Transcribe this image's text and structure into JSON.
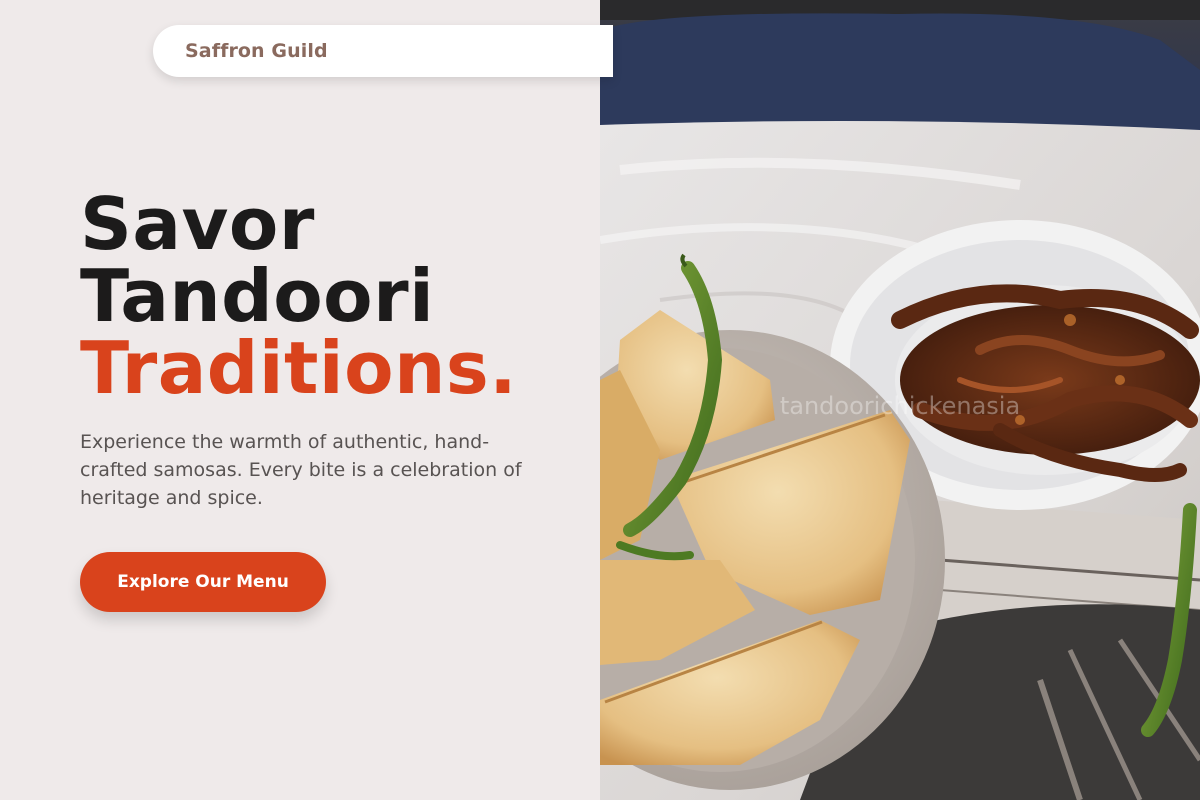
{
  "brand": {
    "name": "Saffron Guild"
  },
  "hero": {
    "headline": {
      "line1": "Savor",
      "line2": "Tandoori",
      "line3": "Traditions."
    },
    "description": "Experience the warmth of authentic, hand-crafted samosas. Every bite is a celebration of heritage and spice.",
    "cta_label": "Explore Our Menu",
    "image": {
      "subject": "samosas with green chilies and jalebi",
      "watermark": "tandoorichickenasia"
    }
  },
  "colors": {
    "accent": "#d9431c",
    "background": "#efeaea",
    "heading": "#1c1b1b",
    "brand": "#8a6a5e",
    "body_text": "#585352"
  }
}
